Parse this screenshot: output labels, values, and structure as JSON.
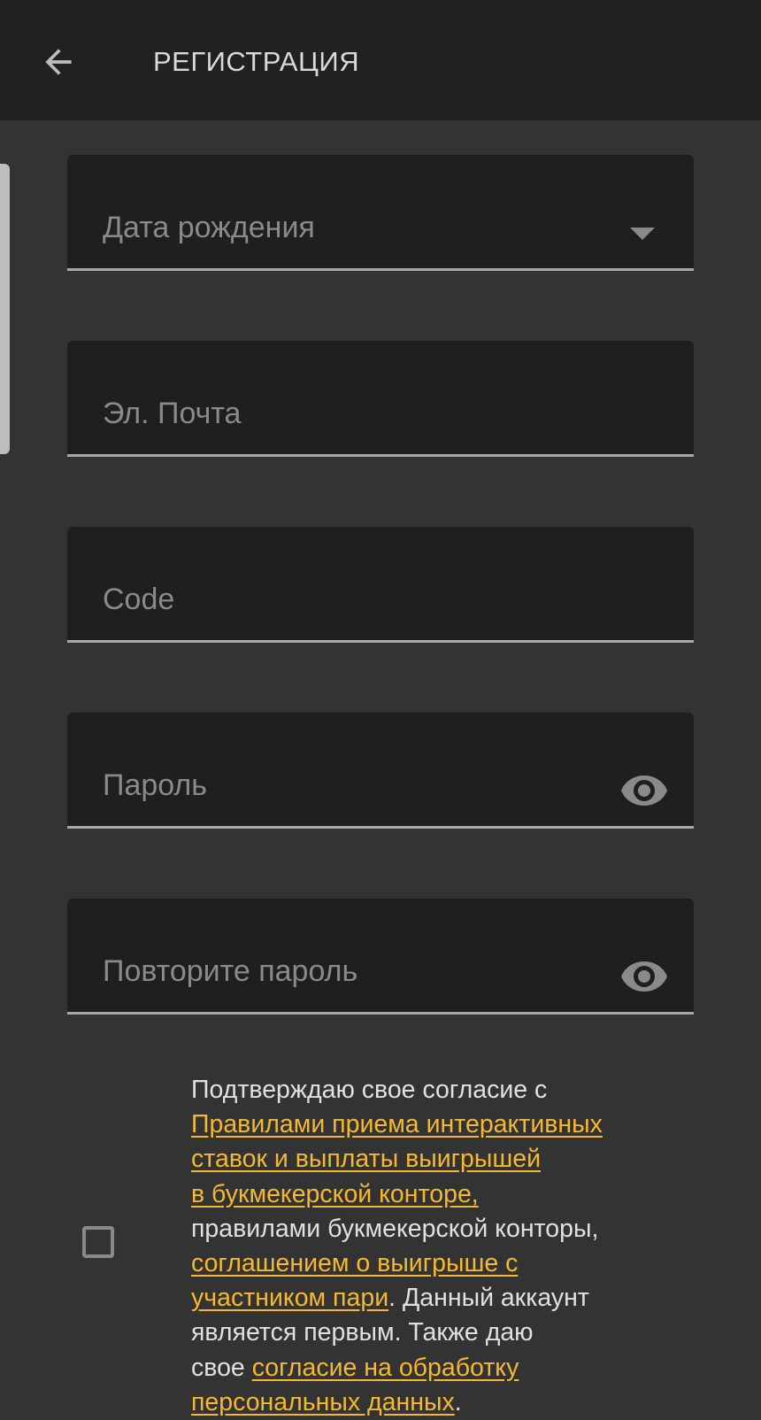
{
  "app_bar": {
    "title": "РЕГИСТРАЦИЯ",
    "back_icon": "arrow-left-icon"
  },
  "form": {
    "birth_date": {
      "label": "Дата рождения",
      "value": "",
      "icon": "chevron-down-icon"
    },
    "email": {
      "label": "Эл. Почта",
      "value": ""
    },
    "code": {
      "label": "Code",
      "value": ""
    },
    "password": {
      "label": "Пароль",
      "value": "",
      "icon": "eye-icon"
    },
    "repeat_password": {
      "label": "Повторите пароль",
      "value": "",
      "icon": "eye-icon"
    }
  },
  "consent": {
    "checked": false,
    "line1": "Подтверждаю свое согласие с",
    "link_rules_l1": "Правилами приема интерактивных",
    "link_rules_l2": "ставок и выплаты выигрышей",
    "link_rules_l3": "в букмекерской конторе,",
    "line5": "правилами букмекерской конторы,",
    "link_agreement_l1": "соглашением о выигрыше с",
    "link_agreement_l2": "участником пари",
    "line7_tail": ". Данный аккаунт",
    "line8": "является первым. Также даю",
    "line9_head": "свое ",
    "link_personal_l1": "согласие на обработку",
    "link_personal_l2": "персональных данных",
    "line10_tail": "."
  },
  "colors": {
    "background": "#333333",
    "app_bar": "#212121",
    "field_background": "#1f1f1f",
    "field_label": "#8a8a8a",
    "field_underline": "#a8a8a8",
    "text": "#e0e0e0",
    "link": "#f5b82e"
  }
}
